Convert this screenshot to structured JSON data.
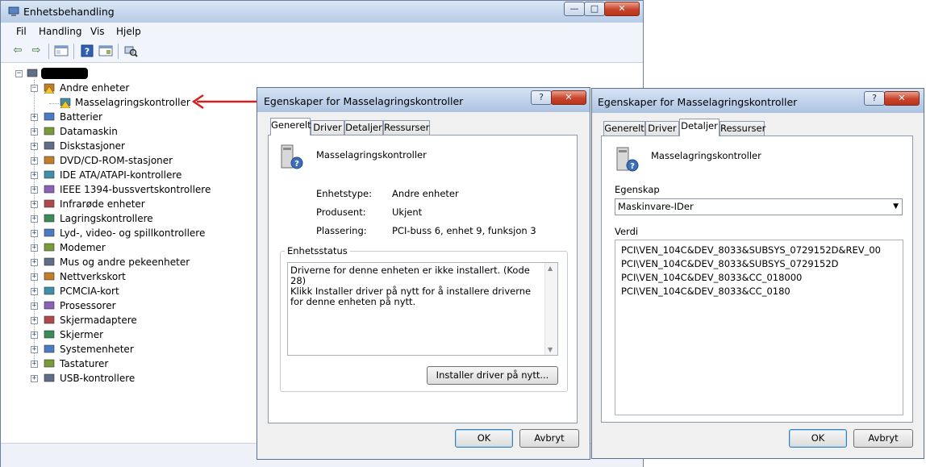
{
  "main": {
    "title": "Enhetsbehandling",
    "controls": {
      "minimize": "—",
      "maximize": "□",
      "close": "✕"
    },
    "menu": [
      "Fil",
      "Handling",
      "Vis",
      "Hjelp"
    ],
    "toolbar_icons": [
      "back-arrow-icon",
      "forward-arrow-icon",
      "properties-window-icon",
      "help-icon",
      "update-driver-icon",
      "scan-hardware-icon"
    ],
    "tree": {
      "root_label": "",
      "other_devices": {
        "label": "Andre enheter",
        "child": "Masselagringskontroller"
      },
      "categories": [
        "Batterier",
        "Datamaskin",
        "Diskstasjoner",
        "DVD/CD-ROM-stasjoner",
        "IDE ATA/ATAPI-kontrollere",
        "IEEE 1394-bussvertskontrollere",
        "Infrarøde enheter",
        "Lagringskontrollere",
        "Lyd-, video- og spillkontrollere",
        "Modemer",
        "Mus og andre pekeenheter",
        "Nettverkskort",
        "PCMCIA-kort",
        "Prosessorer",
        "Skjermadaptere",
        "Skjermer",
        "Systemenheter",
        "Tastaturer",
        "USB-kontrollere"
      ]
    }
  },
  "dialog1": {
    "title": "Egenskaper for Masselagringskontroller",
    "tabs": [
      "Generelt",
      "Driver",
      "Detaljer",
      "Ressurser"
    ],
    "active_tab": "Generelt",
    "device_name": "Masselagringskontroller",
    "fields": [
      {
        "label": "Enhetstype:",
        "value": "Andre enheter"
      },
      {
        "label": "Produsent:",
        "value": "Ukjent"
      },
      {
        "label": "Plassering:",
        "value": "PCI-buss 6, enhet 9, funksjon 3"
      }
    ],
    "status_group": "Enhetsstatus",
    "status_line1": "Driverne for denne enheten er ikke installert. (Kode 28)",
    "status_line2": "Klikk Installer driver på nytt for å installere driverne for denne enheten på nytt.",
    "reinstall_button": "Installer driver på nytt...",
    "ok": "OK",
    "cancel": "Avbryt"
  },
  "dialog2": {
    "title": "Egenskaper for Masselagringskontroller",
    "tabs": [
      "Generelt",
      "Driver",
      "Detaljer",
      "Ressurser"
    ],
    "active_tab": "Detaljer",
    "device_name": "Masselagringskontroller",
    "property_label": "Egenskap",
    "property_value": "Maskinvare-IDer",
    "value_label": "Verdi",
    "values": [
      "PCI\\VEN_104C&DEV_8033&SUBSYS_0729152D&REV_00",
      "PCI\\VEN_104C&DEV_8033&SUBSYS_0729152D",
      "PCI\\VEN_104C&DEV_8033&CC_018000",
      "PCI\\VEN_104C&DEV_8033&CC_0180"
    ],
    "ok": "OK",
    "cancel": "Avbryt"
  },
  "colors": {
    "annotation_arrow": "#d42020",
    "title_bar": "#c4d6ec",
    "dialog_bg": "#f0f0f0"
  }
}
